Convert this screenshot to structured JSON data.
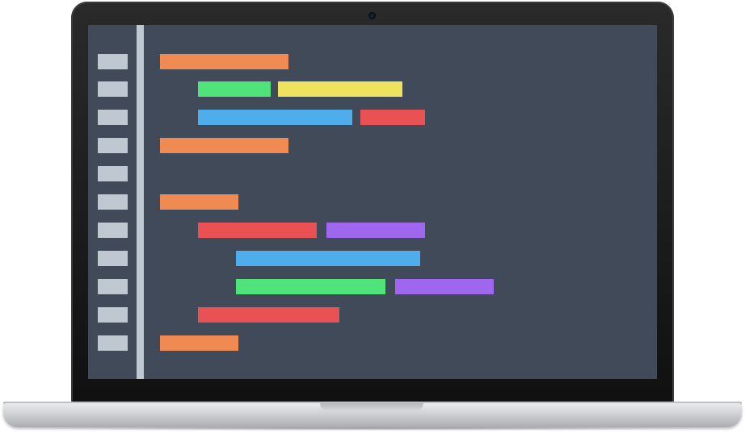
{
  "illustration": "laptop-code-editor",
  "colors": {
    "screen_bg": "#414a59",
    "gutter": "#bfc7d0",
    "orange": "#ef8a53",
    "green": "#4fe37a",
    "yellow": "#eee35e",
    "blue": "#50adeb",
    "red": "#ea5152",
    "purple": "#9f66ee"
  },
  "line_count": 11,
  "code_lines": [
    {
      "bars": [
        {
          "color": "orange"
        }
      ]
    },
    {
      "bars": [
        {
          "color": "green"
        },
        {
          "color": "yellow"
        }
      ]
    },
    {
      "bars": [
        {
          "color": "blue"
        },
        {
          "color": "red"
        }
      ]
    },
    {
      "bars": [
        {
          "color": "orange"
        }
      ]
    },
    {
      "bars": []
    },
    {
      "bars": [
        {
          "color": "orange"
        }
      ]
    },
    {
      "bars": [
        {
          "color": "red"
        },
        {
          "color": "purple"
        }
      ]
    },
    {
      "bars": [
        {
          "color": "blue"
        }
      ]
    },
    {
      "bars": [
        {
          "color": "green"
        },
        {
          "color": "purple"
        }
      ]
    },
    {
      "bars": [
        {
          "color": "red"
        }
      ]
    },
    {
      "bars": [
        {
          "color": "orange"
        }
      ]
    }
  ]
}
